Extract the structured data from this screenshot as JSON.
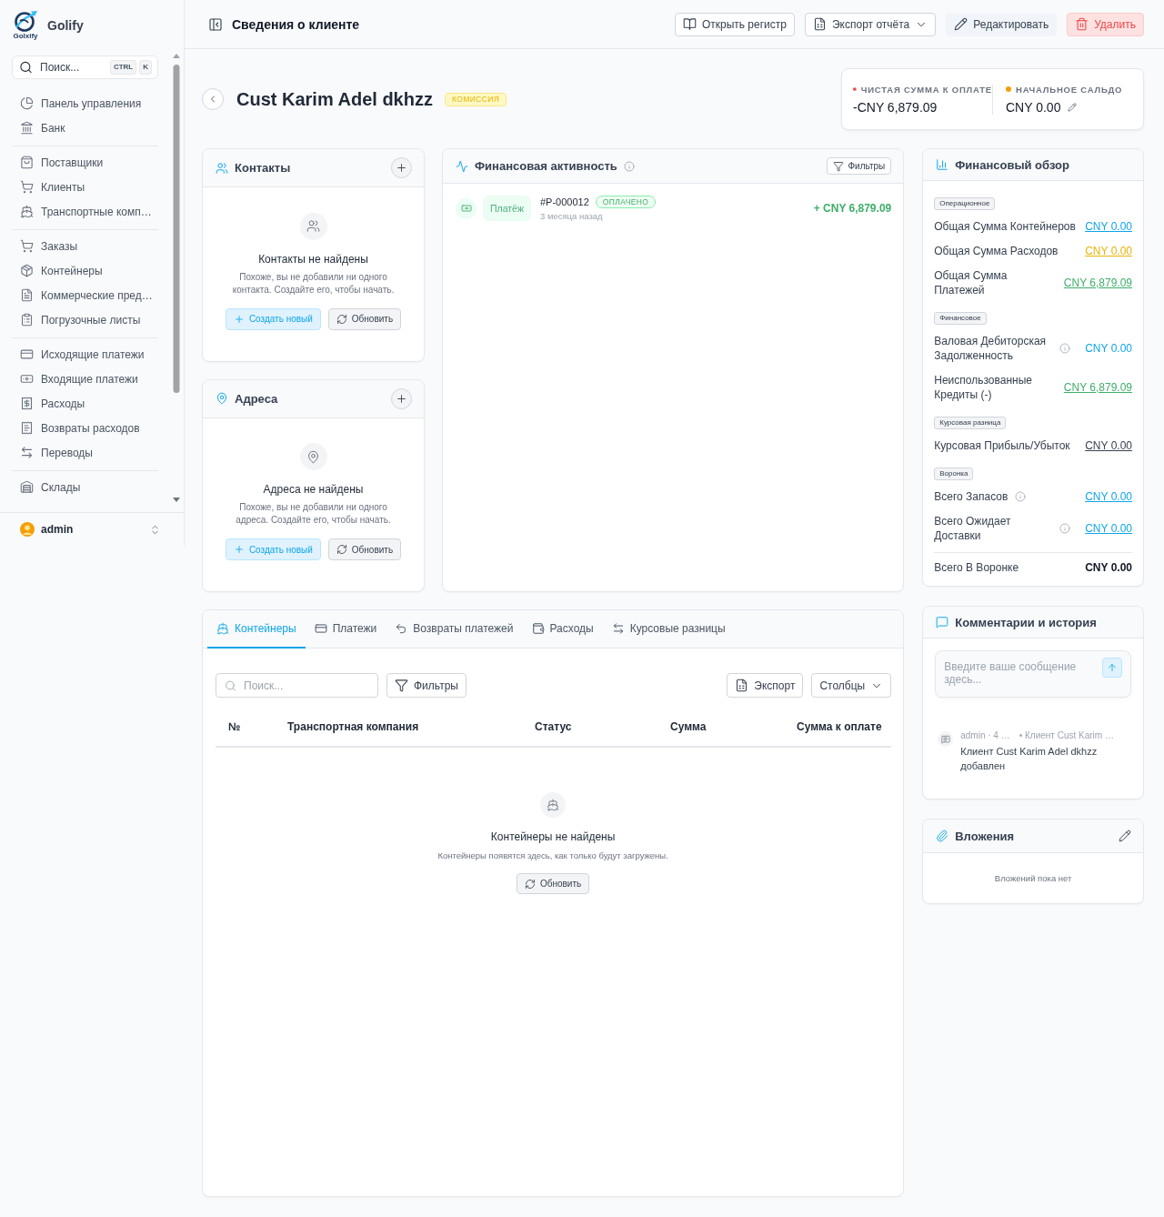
{
  "sidebar": {
    "brand": "Golify",
    "logo_text": "Golxify",
    "search": {
      "placeholder": "Поиск...",
      "keys": [
        "CTRL",
        "K"
      ]
    },
    "groups": [
      {
        "items": [
          "Панель управления",
          "Банк"
        ]
      },
      {
        "items": [
          "Поставщики",
          "Клиенты",
          "Транспортные комп…"
        ]
      },
      {
        "items": [
          "Заказы",
          "Контейнеры",
          "Коммерческие пред…",
          "Погрузочные листы"
        ]
      },
      {
        "items": [
          "Исходящие платежи",
          "Входящие платежи",
          "Расходы",
          "Возвраты расходов",
          "Переводы"
        ]
      },
      {
        "items": [
          "Склады"
        ]
      }
    ],
    "user": {
      "name": "admin"
    }
  },
  "header": {
    "title": "Сведения о клиенте",
    "actions": [
      {
        "label": "Открыть регистр",
        "kind": "outline"
      },
      {
        "label": "Экспорт отчёта",
        "kind": "dropdown"
      },
      {
        "label": "Редактировать",
        "kind": "soft"
      },
      {
        "label": "Удалить",
        "kind": "danger"
      }
    ]
  },
  "customer": {
    "name": "Cust Karim Adel dkhzz",
    "badge": "КОМИССИЯ"
  },
  "summary": [
    {
      "label": "ЧИСТАЯ СУММА К ОПЛАТЕ",
      "value": "-CNY 6,879.09",
      "color": "#ef4444",
      "editable": false
    },
    {
      "label": "НАЧАЛЬНОЕ САЛЬДО",
      "value": "CNY 0.00",
      "color": "#f59e0b",
      "editable": true
    }
  ],
  "contacts": {
    "title": "Контакты",
    "empty_title": "Контакты не найдены",
    "empty_text": "Похоже, вы не добавили ни одного контакта. Создайте его, чтобы начать.",
    "create": "Создать новый",
    "refresh": "Обновить"
  },
  "addresses": {
    "title": "Адреса",
    "empty_title": "Адреса не найдены",
    "empty_text": "Похоже, вы не добавили ни одного адреса. Создайте его, чтобы начать.",
    "create": "Создать новый",
    "refresh": "Обновить"
  },
  "activity": {
    "title": "Финансовая активность",
    "filter": "Фильтры",
    "items": [
      {
        "type": "Платёж",
        "number": "#P-000012",
        "status": "ОПЛАЧЕНО",
        "time": "3 месяца назад",
        "amount": "+ CNY 6,879.09"
      }
    ]
  },
  "overview": {
    "title": "Финансовый обзор",
    "sections": [
      {
        "tag": "Операционное",
        "rows": [
          {
            "label": "Общая Сумма Контейнеров",
            "info": false,
            "value": "CNY 0.00",
            "color": "#0ea5e9",
            "link": true
          },
          {
            "label": "Общая Сумма Расходов",
            "info": false,
            "value": "CNY 0.00",
            "color": "#eab308",
            "link": true
          },
          {
            "label": "Общая Сумма Платежей",
            "info": false,
            "value": "CNY 6,879.09",
            "color": "#3fae6a",
            "link": true
          }
        ]
      },
      {
        "tag": "Финансовое",
        "rows": [
          {
            "label": "Валовая Дебиторская Задолженность",
            "info": true,
            "value": "CNY 0.00",
            "color": "#0ea5e9",
            "link": false
          },
          {
            "label": "Неиспользованные Кредиты (-)",
            "info": false,
            "value": "CNY 6,879.09",
            "color": "#3fae6a",
            "link": true
          }
        ]
      },
      {
        "tag": "Курсовая разница",
        "rows": [
          {
            "label": "Курсовая Прибыль/Убыток",
            "info": false,
            "value": "CNY 0.00",
            "color": "#374151",
            "link": true
          }
        ]
      },
      {
        "tag": "Воронка",
        "rows": [
          {
            "label": "Всего Запасов",
            "info": true,
            "value": "CNY 0.00",
            "color": "#0ea5e9",
            "link": true
          },
          {
            "label": "Всего Ожидает Доставки",
            "info": true,
            "value": "CNY 0.00",
            "color": "#0ea5e9",
            "link": true
          }
        ]
      }
    ],
    "total": {
      "label": "Всего В Воронке",
      "value": "CNY 0.00"
    }
  },
  "records": {
    "tabs": [
      {
        "label": "Контейнеры",
        "selected": true
      },
      {
        "label": "Платежи",
        "selected": false
      },
      {
        "label": "Возвраты платежей",
        "selected": false
      },
      {
        "label": "Расходы",
        "selected": false
      },
      {
        "label": "Курсовые разницы",
        "selected": false
      }
    ],
    "search": {
      "placeholder": "Поиск..."
    },
    "filter": "Фильтры",
    "export": "Экспорт",
    "columns_button": "Столбцы",
    "table": {
      "columns": [
        "№",
        "Транспортная компания",
        "Статус",
        "Сумма",
        "Сумма к оплате"
      ]
    },
    "empty": {
      "title": "Контейнеры не найдены",
      "text": "Контейнеры появятся здесь, как только будут загружены.",
      "refresh": "Обновить"
    }
  },
  "comments": {
    "title": "Комментарии и история",
    "input": {
      "placeholder": "Введите ваше сообщение здесь..."
    },
    "history": [
      {
        "meta": "admin · 4 …",
        "context": "• Клиент Cust Karim …",
        "text": "Клиент Cust Karim Adel dkhzz добавлен"
      }
    ]
  },
  "attachments": {
    "title": "Вложения",
    "empty": "Вложений пока нет"
  }
}
